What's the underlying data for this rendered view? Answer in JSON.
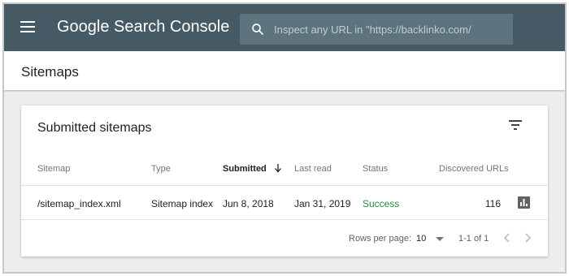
{
  "header": {
    "product_title": "Google Search Console",
    "search_placeholder": "Inspect any URL in \"https://backlinko.com/"
  },
  "page": {
    "title": "Sitemaps"
  },
  "card": {
    "title": "Submitted sitemaps",
    "columns": [
      "Sitemap",
      "Type",
      "Submitted",
      "Last read",
      "Status",
      "Discovered URLs"
    ],
    "rows": [
      {
        "sitemap": "/sitemap_index.xml",
        "type": "Sitemap index",
        "submitted": "Jun 8, 2018",
        "last_read": "Jan 31, 2019",
        "status": "Success",
        "discovered_urls": "116"
      }
    ],
    "footer": {
      "rows_per_page_label": "Rows per page:",
      "rows_per_page_value": "10",
      "range": "1-1 of 1"
    }
  },
  "colors": {
    "topbar": "#455a64",
    "search_box": "#5d737e",
    "success": "#1e8e3e"
  },
  "icons": [
    "menu-icon",
    "search-icon",
    "filter-icon",
    "sort-down-arrow-icon",
    "bar-chart-icon",
    "dropdown-arrow-icon",
    "chevron-left-icon",
    "chevron-right-icon"
  ]
}
